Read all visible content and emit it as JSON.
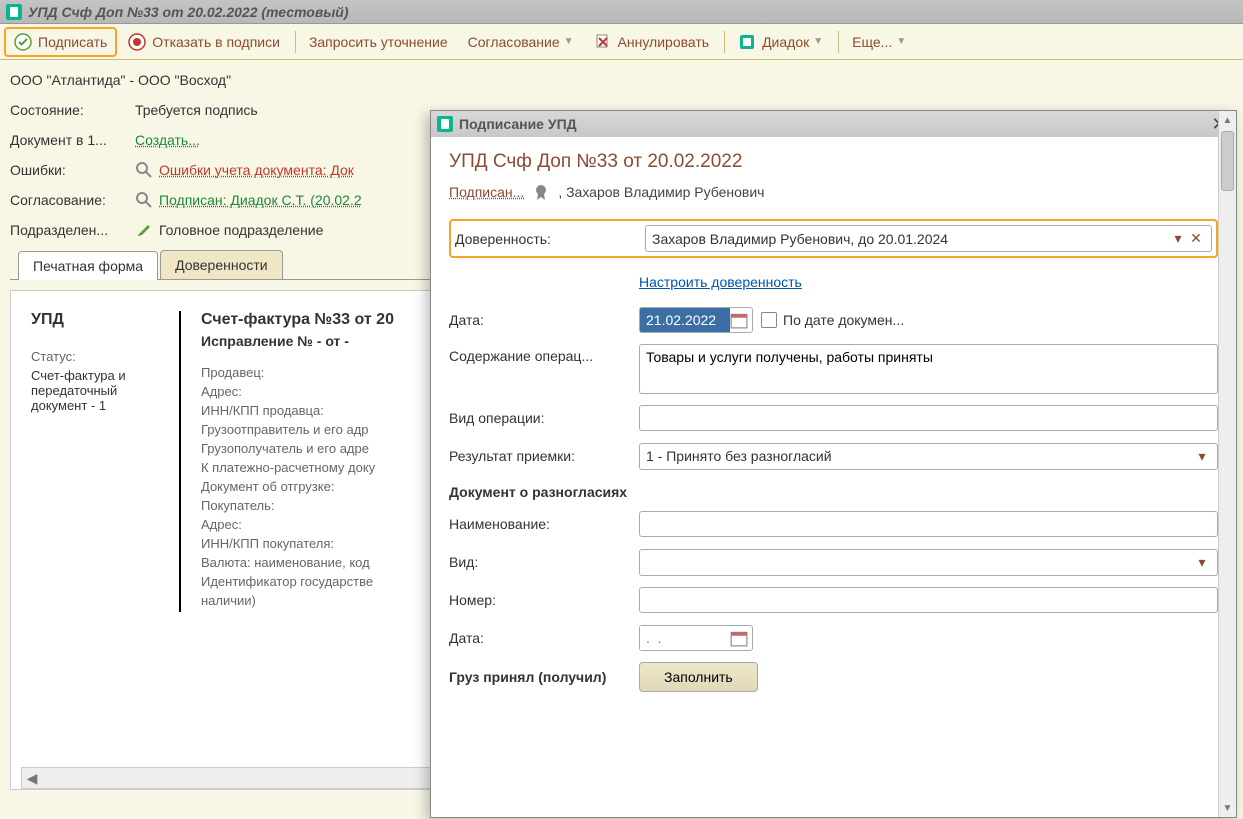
{
  "window": {
    "title": "УПД Счф Доп №33 от 20.02.2022 (тестовый)"
  },
  "toolbar": {
    "sign": "Подписать",
    "reject": "Отказать в подписи",
    "request": "Запросить уточнение",
    "approval": "Согласование",
    "annul": "Аннулировать",
    "diadoc": "Диадок",
    "more": "Еще..."
  },
  "info": {
    "orgs": "ООО \"Атлантида\" - ООО \"Восход\"",
    "state_label": "Состояние:",
    "state_value": "Требуется подпись",
    "doc1c_label": "Документ в 1...",
    "doc1c_link": "Создать...",
    "errors_label": "Ошибки:",
    "errors_value": "Ошибки учета документа: Док",
    "approval_label": "Согласование:",
    "approval_value": "Подписан: Диадок С.Т. (20.02.2",
    "dept_label": "Подразделен...",
    "dept_value": "Головное подразделение"
  },
  "tabs": {
    "print": "Печатная форма",
    "poa": "Доверенности"
  },
  "print": {
    "upd": "УПД",
    "status_label": "Статус:",
    "status_value": "Счет-фактура и передаточный документ - 1",
    "invoice_title": "Счет-фактура №33 от 20",
    "correction": "Исправление № - от -",
    "fields": [
      "Продавец:",
      "Адрес:",
      "ИНН/КПП продавца:",
      "Грузоотправитель и его адр",
      "Грузополучатель и его адре",
      "К платежно-расчетному доку",
      "Документ об отгрузке:",
      "Покупатель:",
      "Адрес:",
      "ИНН/КПП покупателя:",
      "Валюта: наименование, код",
      "Идентификатор государстве",
      "наличии)"
    ]
  },
  "modal": {
    "title": "Подписание УПД",
    "heading": "УПД Счф Доп №33 от 20.02.2022",
    "signer_label": "Подписан...",
    "signer_name": ", Захаров Владимир Рубенович",
    "poa_label": "Доверенность:",
    "poa_value": "Захаров Владимир Рубенович, до 20.01.2024",
    "poa_link": "Настроить доверенность",
    "date_label": "Дата:",
    "date_value": "21.02.2022",
    "by_doc_date": "По дате докумен...",
    "content_label": "Содержание операц...",
    "content_value": "Товары и услуги получены, работы приняты",
    "optype_label": "Вид операции:",
    "optype_value": "",
    "result_label": "Результат приемки:",
    "result_value": "1 - Принято без разногласий",
    "dispute_header": "Документ о разногласиях",
    "dname_label": "Наименование:",
    "dtype_label": "Вид:",
    "dnum_label": "Номер:",
    "ddate_label": "Дата:",
    "ddate_placeholder": ".  .",
    "cargo_label": "Груз принял (получил)",
    "fill_btn": "Заполнить"
  }
}
